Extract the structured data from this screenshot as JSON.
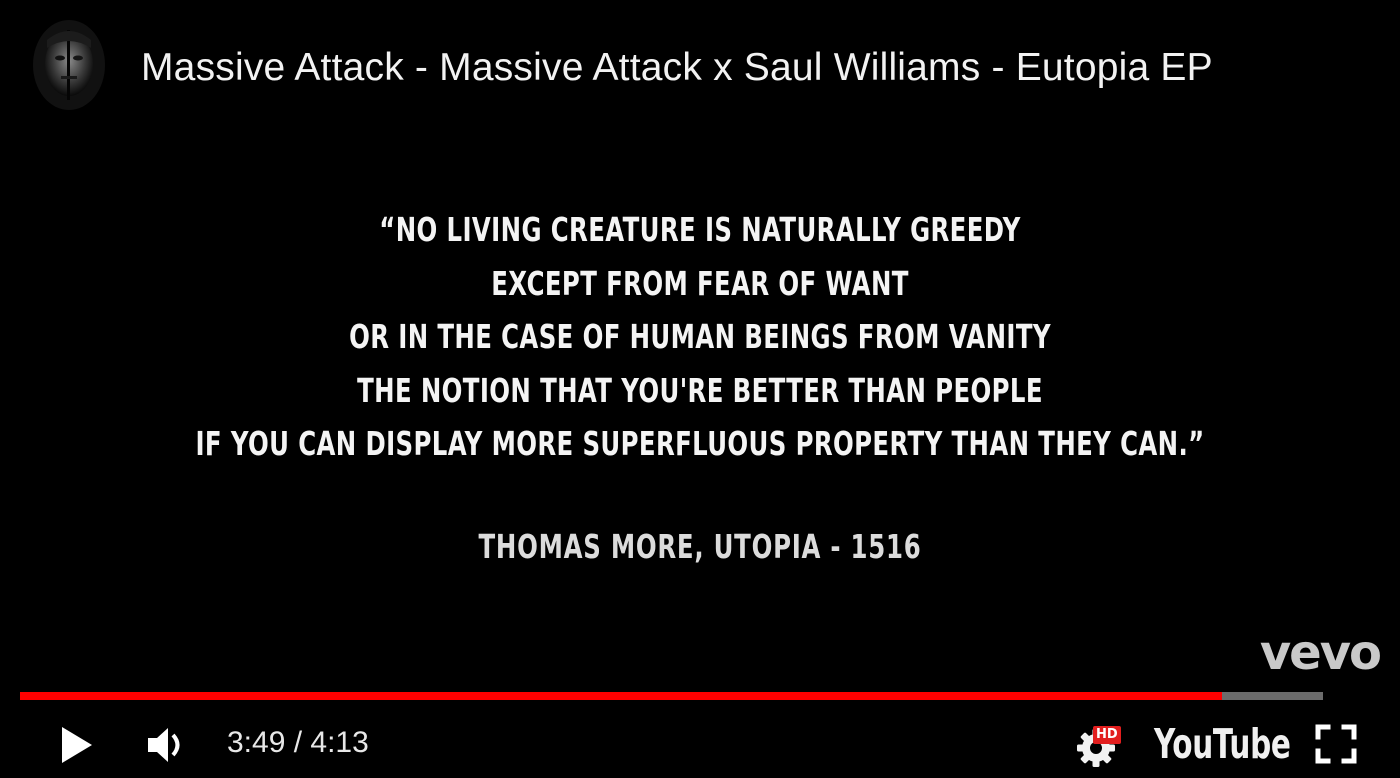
{
  "header": {
    "channel_avatar_icon": "channel-avatar-face",
    "title": "Massive Attack - Massive Attack x Saul Williams - Eutopia EP"
  },
  "video": {
    "quote_lines": [
      "“NO LIVING CREATURE IS NATURALLY GREEDY",
      "EXCEPT FROM FEAR OF WANT",
      "OR IN THE CASE OF HUMAN BEINGS FROM VANITY",
      "THE NOTION THAT YOU'RE BETTER THAN PEOPLE",
      "IF YOU CAN DISPLAY MORE SUPERFLUOUS PROPERTY THAN THEY CAN.”"
    ],
    "attribution": "THOMAS MORE, UTOPIA - 1516",
    "watermark": "vevo"
  },
  "controls": {
    "progress_fraction": 0.9225,
    "current_time": "3:49",
    "duration": "4:13",
    "time_separator": " / ",
    "hd_badge": "HD",
    "youtube_logo": "YouTube",
    "icons": {
      "play": "play-icon",
      "volume": "volume-icon",
      "settings": "gear-icon",
      "fullscreen": "fullscreen-icon"
    },
    "colors": {
      "progress_played": "#ff0000",
      "progress_remaining": "#6b6b6b",
      "hd_badge": "#e21e1e"
    }
  }
}
